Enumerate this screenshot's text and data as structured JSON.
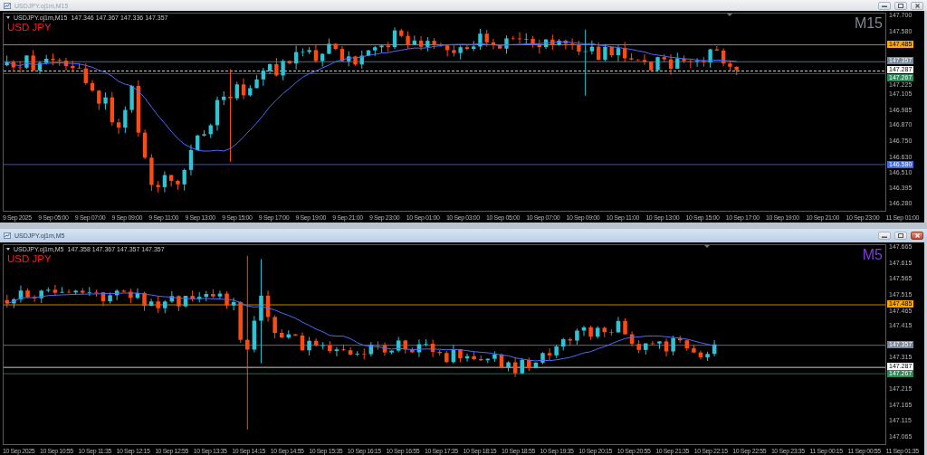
{
  "panes": [
    {
      "title": "USDJPY.oj1m,M15",
      "active": false,
      "symbol_info": "USDJPY.oj1m,M15",
      "ohlc": "147.346 147.367 147.336 147.357",
      "symbol": "USD JPY",
      "timeframe": {
        "label": "M15",
        "color": "#7d8796"
      },
      "price_ticks": [
        "147.700",
        "147.580",
        "147.225",
        "147.105",
        "146.985",
        "146.870",
        "146.750",
        "146.630",
        "146.510",
        "146.395",
        "146.280"
      ],
      "levels": [
        {
          "price": "147.485",
          "color": "#ffa500",
          "kind": "solid"
        },
        {
          "price": "147.357",
          "color": "#778899",
          "kind": "solid"
        },
        {
          "price": "147.287",
          "color": "#ffffff",
          "kind": "dashed"
        },
        {
          "price": "147.267",
          "color": "#2e8b57",
          "kind": "solid"
        },
        {
          "price": "146.580",
          "color": "#4169e1",
          "kind": "solid"
        }
      ],
      "time_labels": [
        "9 Sep 2025",
        "9 Sep 05:00",
        "9 Sep 07:00",
        "9 Sep 09:00",
        "9 Sep 11:00",
        "9 Sep 13:00",
        "9 Sep 15:00",
        "9 Sep 17:00",
        "9 Sep 19:00",
        "9 Sep 21:00",
        "9 Sep 23:00",
        "10 Sep 01:00",
        "10 Sep 03:00",
        "10 Sep 05:00",
        "10 Sep 07:00",
        "10 Sep 09:00",
        "10 Sep 11:00",
        "10 Sep 13:00",
        "10 Sep 15:00",
        "10 Sep 17:00",
        "10 Sep 19:00",
        "10 Sep 21:00",
        "10 Sep 23:00",
        "11 Sep 01:00"
      ]
    },
    {
      "title": "USDJPY.oj1m,M5",
      "active": true,
      "symbol_info": "USDJPY.oj1m,M5",
      "ohlc": "147.358 147.367 147.357 147.357",
      "symbol": "USD JPY",
      "timeframe": {
        "label": "M5",
        "color": "#7b3fd6"
      },
      "price_ticks": [
        "147.665",
        "147.615",
        "147.565",
        "147.515",
        "147.465",
        "147.415",
        "147.315",
        "147.215",
        "147.165",
        "147.115",
        "147.065"
      ],
      "levels": [
        {
          "price": "147.485",
          "color": "#ffa500",
          "kind": "solid"
        },
        {
          "price": "147.357",
          "color": "#778899",
          "kind": "solid"
        },
        {
          "price": "147.287",
          "color": "#ffffff",
          "kind": "solid"
        },
        {
          "price": "147.267",
          "color": "#2e8b57",
          "kind": "solid"
        }
      ],
      "time_labels": [
        "10 Sep 2025",
        "10 Sep 10:55",
        "10 Sep 11:35",
        "10 Sep 12:15",
        "10 Sep 12:55",
        "10 Sep 13:35",
        "10 Sep 14:15",
        "10 Sep 14:55",
        "10 Sep 15:35",
        "10 Sep 16:15",
        "10 Sep 16:55",
        "10 Sep 17:35",
        "10 Sep 18:15",
        "10 Sep 18:55",
        "10 Sep 19:35",
        "10 Sep 20:15",
        "10 Sep 20:55",
        "10 Sep 21:35",
        "10 Sep 22:15",
        "10 Sep 22:55",
        "10 Sep 23:35",
        "11 Sep 00:15",
        "11 Sep 00:55",
        "11 Sep 01:35"
      ]
    }
  ]
}
